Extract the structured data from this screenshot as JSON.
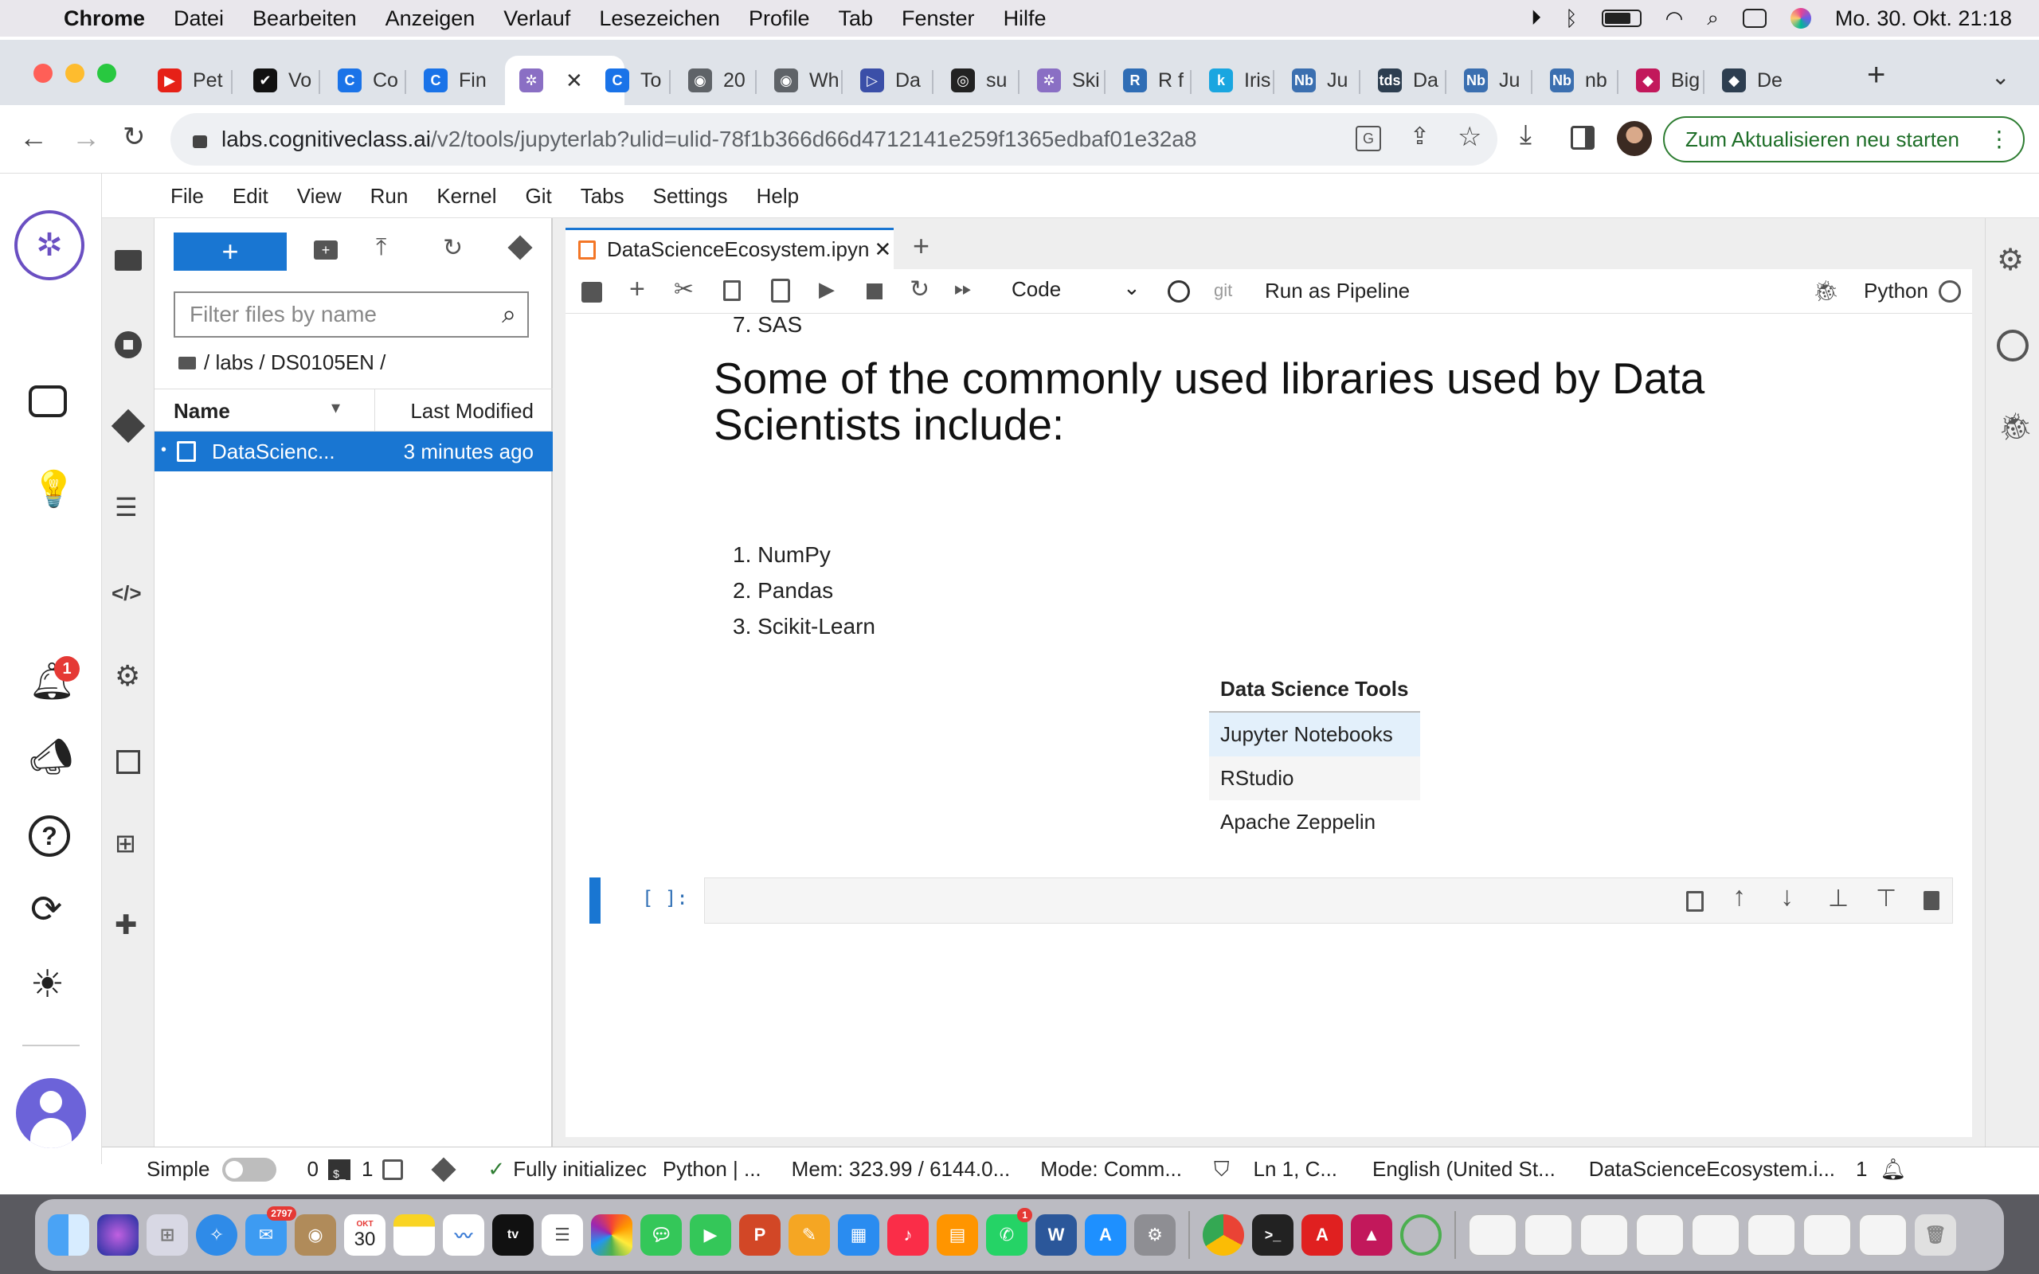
{
  "mac_menubar": {
    "app": "Chrome",
    "items": [
      "Datei",
      "Bearbeiten",
      "Anzeigen",
      "Verlauf",
      "Lesezeichen",
      "Profile",
      "Tab",
      "Fenster",
      "Hilfe"
    ],
    "clock": "Mo. 30. Okt.  21:18"
  },
  "browser": {
    "tabs": [
      {
        "label": "Pet",
        "color": "#e62117",
        "glyph": "▶"
      },
      {
        "label": "Vo",
        "color": "#111111",
        "glyph": "✔"
      },
      {
        "label": "Co",
        "color": "#1a73e8",
        "glyph": "C"
      },
      {
        "label": "Fin",
        "color": "#1a73e8",
        "glyph": "C"
      },
      {
        "label": "",
        "color": "#8a6fc4",
        "glyph": "✲",
        "active": true
      },
      {
        "label": "To",
        "color": "#1a73e8",
        "glyph": "C"
      },
      {
        "label": "20",
        "color": "#5f6368",
        "glyph": "◉"
      },
      {
        "label": "Wh",
        "color": "#5f6368",
        "glyph": "◉"
      },
      {
        "label": "Da",
        "color": "#3b4fa8",
        "glyph": "▷"
      },
      {
        "label": "su",
        "color": "#222222",
        "glyph": "◎"
      },
      {
        "label": "Ski",
        "color": "#8a6fc4",
        "glyph": "✲"
      },
      {
        "label": "R f",
        "color": "#2f6db5",
        "glyph": "R"
      },
      {
        "label": "Iris",
        "color": "#1aa6e0",
        "glyph": "k"
      },
      {
        "label": "Ju",
        "color": "#3b6fb0",
        "glyph": "Nb"
      },
      {
        "label": "Da",
        "color": "#2d3e50",
        "glyph": "tds"
      },
      {
        "label": "Ju",
        "color": "#3b6fb0",
        "glyph": "Nb"
      },
      {
        "label": "nb",
        "color": "#3b6fb0",
        "glyph": "Nb"
      },
      {
        "label": "Big",
        "color": "#c2185b",
        "glyph": "◆"
      },
      {
        "label": "De",
        "color": "#2d3e50",
        "glyph": "◆"
      }
    ],
    "url_host": "labs.cognitiveclass.ai",
    "url_path": "/v2/tools/jupyterlab?ulid=ulid-78f1b366d66d4712141e259f1365edbaf01e32a8",
    "update_button": "Zum Aktualisieren neu starten"
  },
  "jupyter": {
    "menu": [
      "File",
      "Edit",
      "View",
      "Run",
      "Kernel",
      "Git",
      "Tabs",
      "Settings",
      "Help"
    ],
    "filter_placeholder": "Filter files by name",
    "breadcrumb": "/ labs / DS0105EN /",
    "col_name": "Name",
    "col_modified": "Last Modified",
    "files": [
      {
        "name": "DataScienc...",
        "modified": "3 minutes ago"
      }
    ],
    "tab_title": "DataScienceEcosystem.ipyn",
    "cell_type": "Code",
    "git_label": "git",
    "pipeline_label": "Run as Pipeline",
    "kernel_name": "Python",
    "notebook": {
      "prev_item": "7. SAS",
      "heading": "Some of the commonly used libraries used by Data Scientists include:",
      "libraries": [
        "1. NumPy",
        "2. Pandas",
        "3. Scikit-Learn"
      ],
      "table_header": "Data Science Tools",
      "table_rows": [
        "Jupyter Notebooks",
        "RStudio",
        "Apache Zeppelin"
      ],
      "prompt": "[ ]:"
    },
    "status": {
      "mode": "Simple",
      "terminals": "0",
      "kernels": "1",
      "init": "Fully initializec",
      "kernel": "Python | ...",
      "mem": "Mem: 323.99 / 6144.0...",
      "cmd_mode": "Mode: Comm...",
      "position": "Ln 1, C...",
      "language": "English (United St...",
      "file": "DataScienceEcosystem.i...",
      "count": "1"
    },
    "notification_count": "1"
  },
  "dock": {
    "mail_badge": "2797",
    "calendar_month": "OKT",
    "calendar_day": "30",
    "whatsapp_badge": "1"
  }
}
